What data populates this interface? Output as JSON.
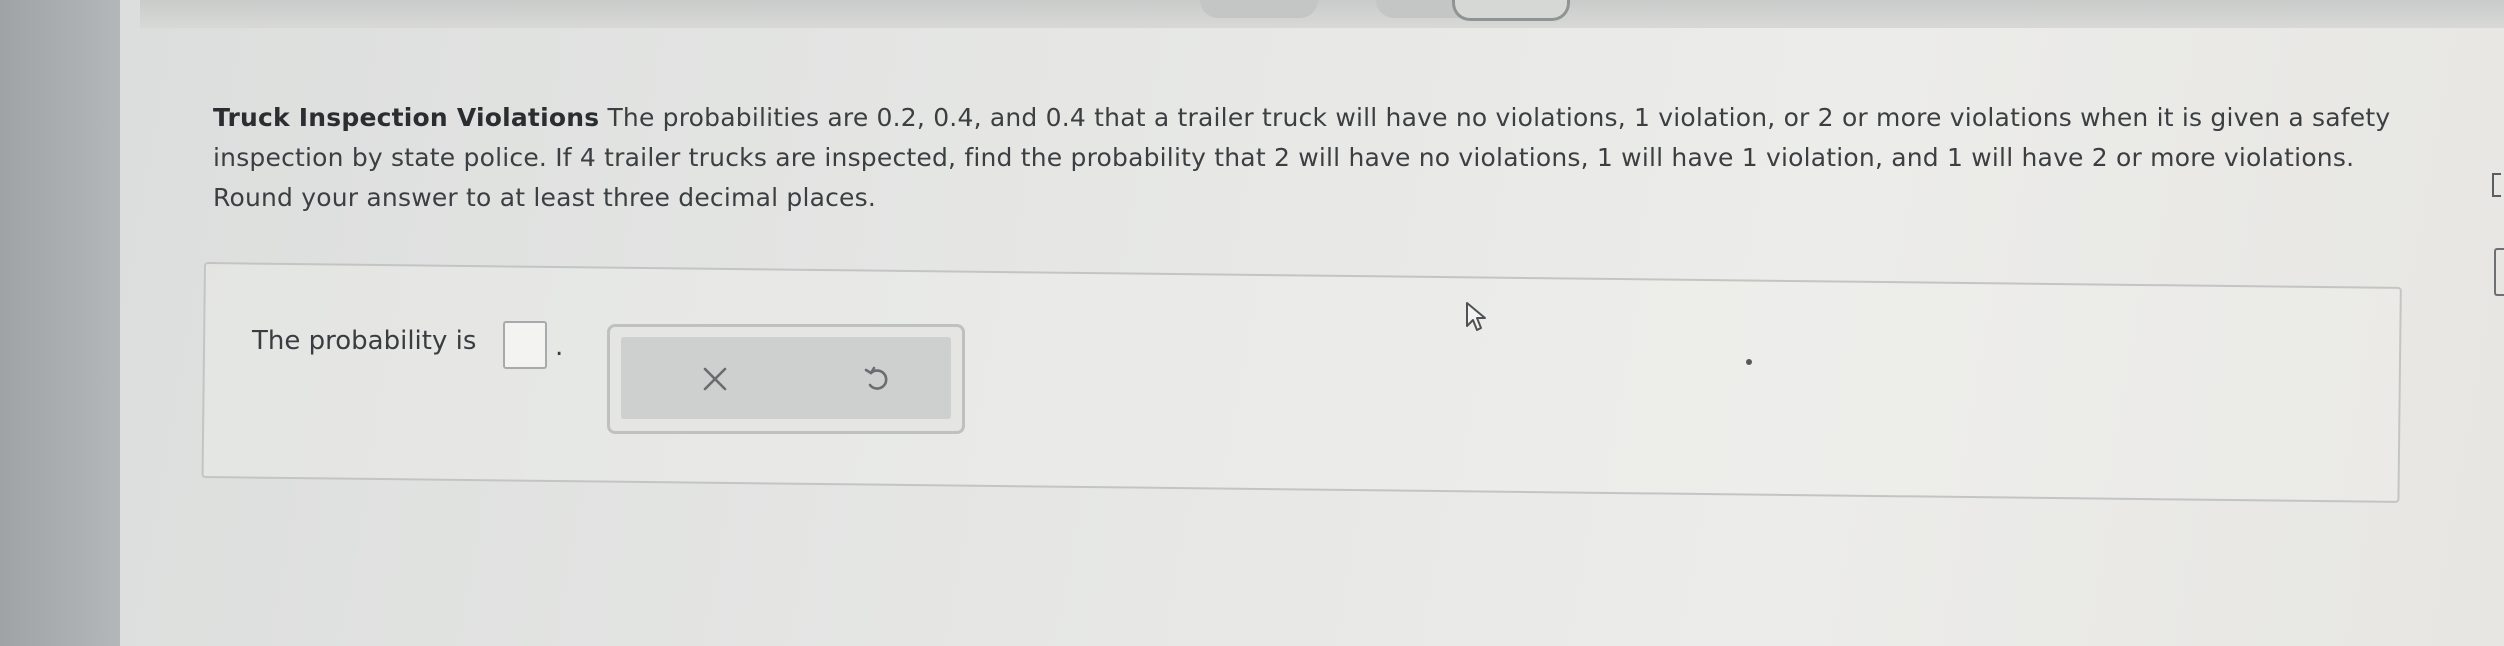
{
  "question": {
    "title": "Truck Inspection Violations",
    "body": " The probabilities are 0.2, 0.4, and 0.4 that a trailer truck will have no violations, 1 violation, or 2 or more violations when it is given a safety inspection by state police. If 4 trailer trucks are inspected, find the probability that 2 will have no violations, 1 will have 1 violation, and 1 will have 2 or more violations. Round your answer to at least three decimal places."
  },
  "answer": {
    "label": "The probability is",
    "value": "",
    "trailing": "."
  },
  "tools": {
    "clear_icon": "x-icon",
    "undo_icon": "undo-icon"
  },
  "colors": {
    "text": "#3c3f42",
    "panel_border": "#c3c5c4",
    "tool_background": "#cdd0cf"
  }
}
